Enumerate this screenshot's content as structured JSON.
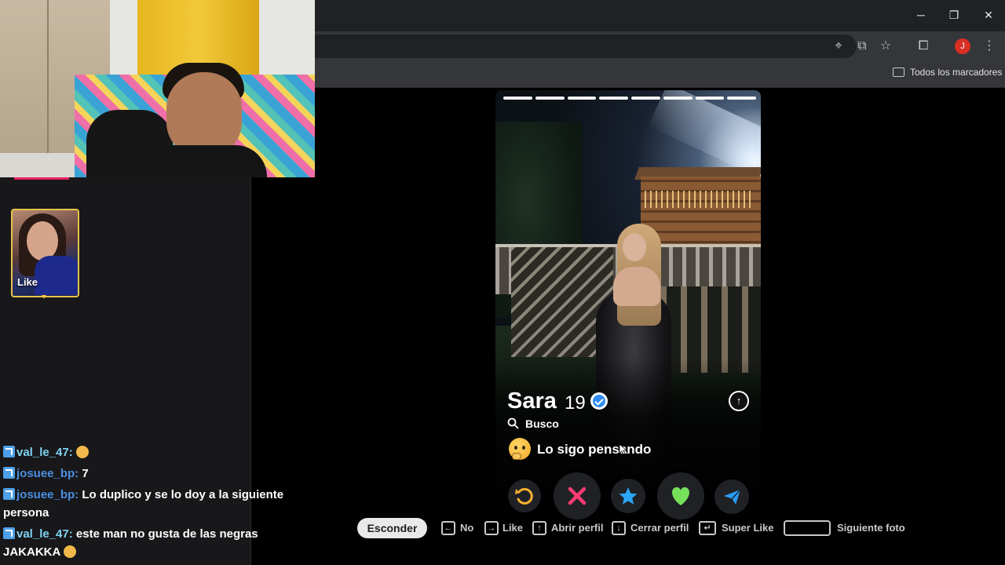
{
  "bookmarks": {
    "all_label": "Todos los marcadores"
  },
  "browser": {
    "profile_initial": "J"
  },
  "like_card": {
    "label": "Like"
  },
  "chat": {
    "messages": [
      {
        "user": "val_le_47:",
        "text": ""
      },
      {
        "user": "josuee_bp:",
        "text": "7"
      },
      {
        "user": "josuee_bp:",
        "text": "Lo duplico y se lo doy a la siguiente persona"
      },
      {
        "user": "val_le_47:",
        "text": "este man no gusta de las negras JAKAKKA"
      }
    ]
  },
  "profile": {
    "name": "Sara",
    "age": "19",
    "looking_label": "Busco",
    "looking_value": "Lo sigo pensando",
    "photo_count": 8
  },
  "shortcuts": {
    "hide_button": "Esconder",
    "no": "No",
    "like": "Like",
    "open_profile": "Abrir perfil",
    "close_profile": "Cerrar perfil",
    "super_like": "Super Like",
    "next_photo": "Siguiente foto"
  },
  "colors": {
    "nope": "#fe3c72",
    "super_like": "#2aa6f5",
    "like": "#76e05b",
    "rewind": "#f6b12f",
    "boost": "#2a9df4"
  }
}
